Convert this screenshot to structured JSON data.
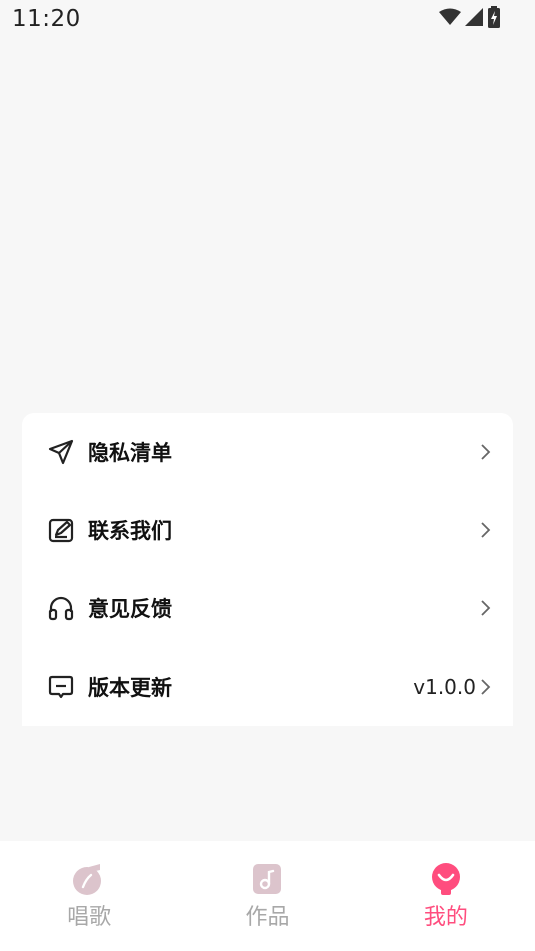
{
  "status_bar": {
    "time": "11:20",
    "icons": [
      "wifi-icon",
      "cellular-signal-icon",
      "battery-charging-icon"
    ]
  },
  "menu": {
    "items": [
      {
        "label": "隐私清单",
        "icon": "send-icon",
        "value": ""
      },
      {
        "label": "联系我们",
        "icon": "edit-note-icon",
        "value": ""
      },
      {
        "label": "意见反馈",
        "icon": "headphones-icon",
        "value": ""
      },
      {
        "label": "版本更新",
        "icon": "message-box-icon",
        "value": "v1.0.0"
      }
    ]
  },
  "bottom_nav": {
    "tabs": [
      {
        "label": "唱歌",
        "icon": "music-note-circle-icon",
        "active": false
      },
      {
        "label": "作品",
        "icon": "music-file-icon",
        "active": false
      },
      {
        "label": "我的",
        "icon": "smiley-profile-icon",
        "active": true
      }
    ]
  },
  "colors": {
    "accent": "#ff4d7e",
    "inactive": "#a8a8a8",
    "inactive_icon": "#dcc4cc",
    "background": "#f7f7f7"
  }
}
